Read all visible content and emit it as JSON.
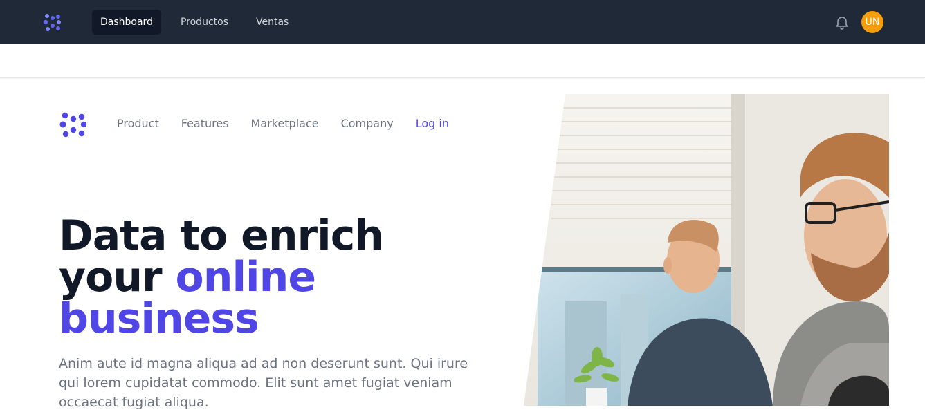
{
  "app_nav": {
    "items": [
      {
        "label": "Dashboard",
        "active": true
      },
      {
        "label": "Productos",
        "active": false
      },
      {
        "label": "Ventas",
        "active": false
      }
    ],
    "avatar_initials": "UN",
    "avatar_color": "#f59e0b",
    "logo_icon": "brand-logo-icon",
    "notification_icon": "bell-icon"
  },
  "hero": {
    "nav": {
      "product": "Product",
      "features": "Features",
      "marketplace": "Marketplace",
      "company": "Company",
      "login": "Log in"
    },
    "headline_line1": "Data to enrich",
    "headline_your": "your",
    "headline_online": "online",
    "headline_business": "business",
    "description": "Anim aute id magna aliqua ad ad non deserunt sunt. Qui irure qui lorem cupidatat commodo. Elit sunt amet fugiat veniam occaecat fugiat aliqua."
  },
  "colors": {
    "topbar_bg": "#1f2937",
    "accent": "#4f46e5",
    "heading": "#111827",
    "muted_text": "#6b7280"
  }
}
